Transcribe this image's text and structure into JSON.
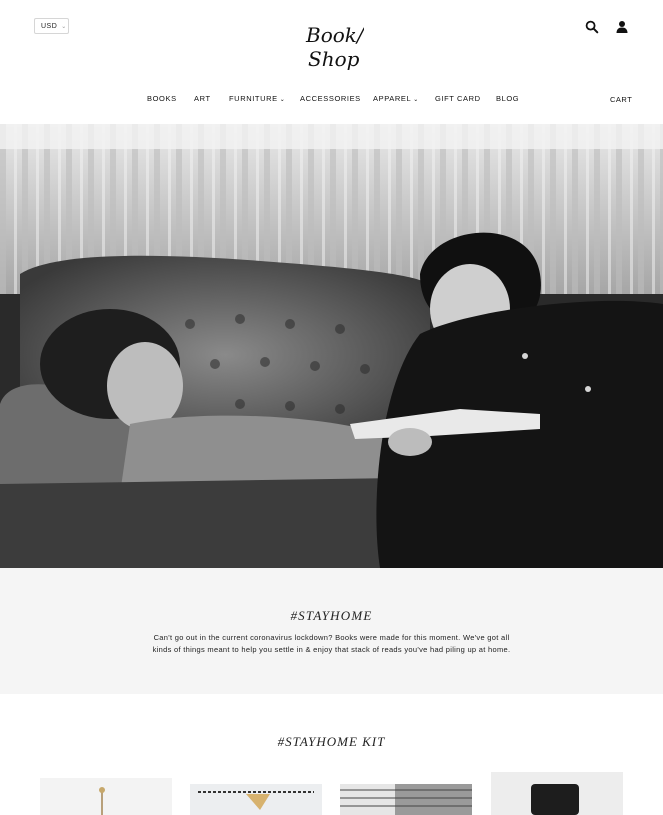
{
  "header": {
    "currency": "USD",
    "logo_lines": [
      "Book/",
      "Shop"
    ],
    "search_icon": "search-icon",
    "account_icon": "user-icon",
    "cart_label": "CART"
  },
  "nav": {
    "items": [
      {
        "label": "BOOKS",
        "dropdown": false
      },
      {
        "label": "ART",
        "dropdown": false
      },
      {
        "label": "FURNITURE",
        "dropdown": true
      },
      {
        "label": "ACCESSORIES",
        "dropdown": false
      },
      {
        "label": "APPAREL",
        "dropdown": true
      },
      {
        "label": "GIFT CARD",
        "dropdown": false
      },
      {
        "label": "BLOG",
        "dropdown": false
      }
    ]
  },
  "hero": {
    "image": "Black and white photo of a woman reclining on a tufted sofa while a man sits beside her reading a book"
  },
  "stayhome": {
    "title": "#STAYHOME",
    "line1": "Can't go out in the current coronavirus lockdown? Books were made for this moment. We've got all",
    "line2": "kinds of things meant to help you settle in & enjoy that stack of reads you've had piling up at home."
  },
  "kit": {
    "title": "#STAYHOME KIT"
  }
}
